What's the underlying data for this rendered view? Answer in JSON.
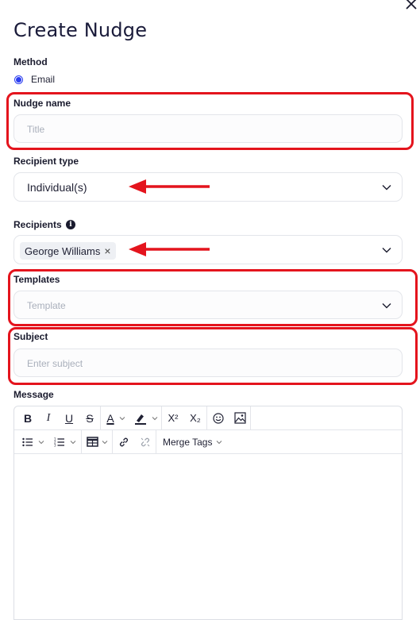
{
  "dialog": {
    "title": "Create Nudge"
  },
  "method": {
    "label": "Method",
    "option": "Email"
  },
  "nudge_name": {
    "label": "Nudge name",
    "placeholder": "Title"
  },
  "recipient_type": {
    "label": "Recipient type",
    "value": "Individual(s)"
  },
  "recipients": {
    "label": "Recipients",
    "info_glyph": "i",
    "chips": [
      "George Williams"
    ],
    "chip_remove": "×"
  },
  "templates": {
    "label": "Templates",
    "placeholder": "Template"
  },
  "subject": {
    "label": "Subject",
    "placeholder": "Enter subject"
  },
  "message": {
    "label": "Message",
    "toolbar": {
      "bold": "B",
      "italic": "I",
      "underline": "U",
      "strike": "S",
      "font_color": "A",
      "superscript": "X²",
      "subscript": "X₂",
      "merge_tags": "Merge Tags"
    }
  },
  "colors": {
    "accent": "#2b3ef0",
    "annotation_red": "#e4141d",
    "border": "#e3e5ea"
  }
}
